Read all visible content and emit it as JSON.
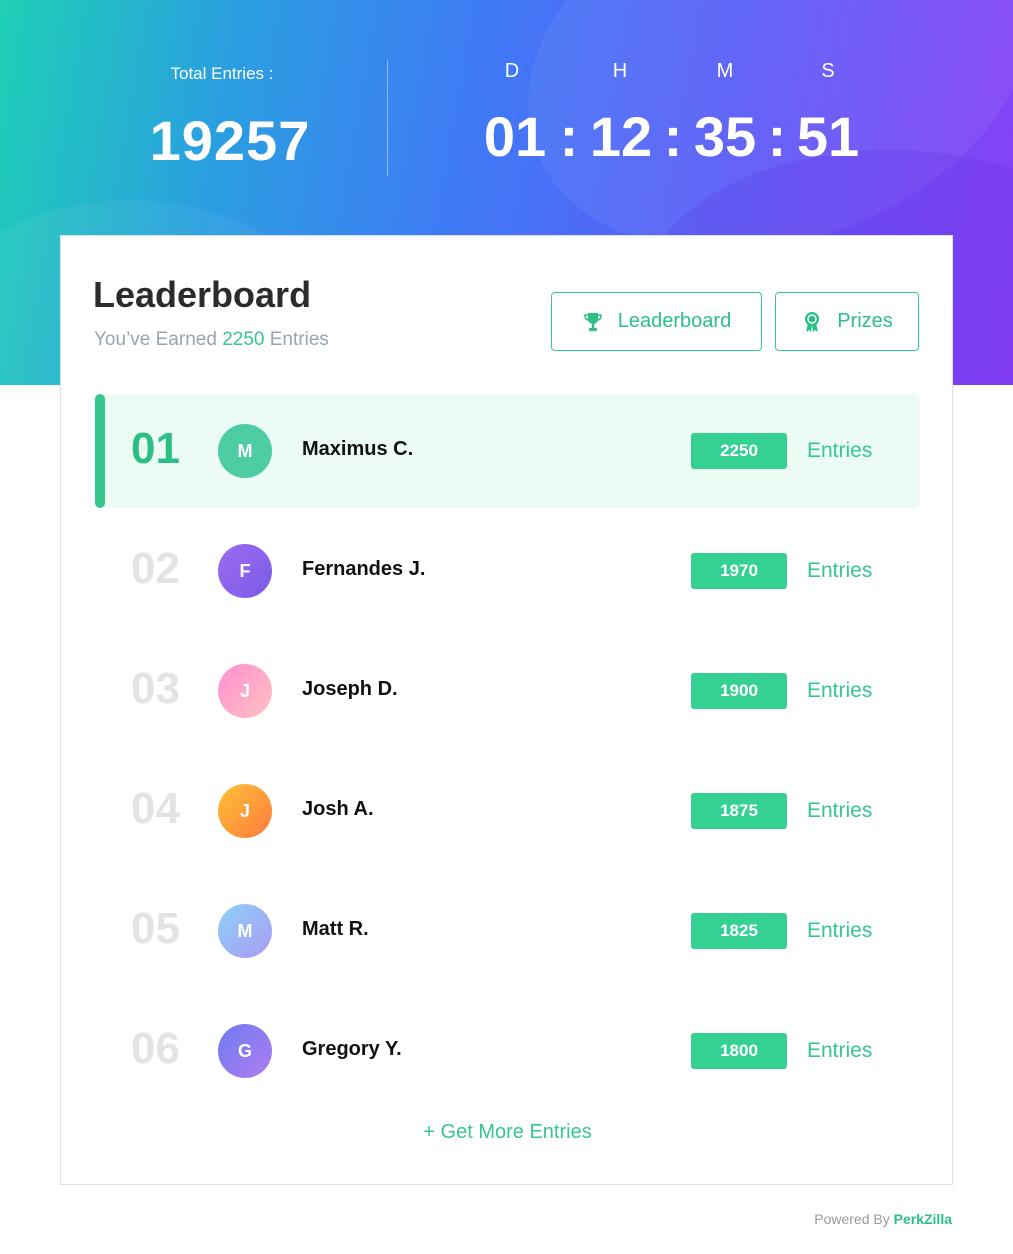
{
  "header": {
    "total_label": "Total Entries :",
    "total_value": "19257",
    "countdown": {
      "labels": [
        "D",
        "H",
        "M",
        "S"
      ],
      "values": [
        "01",
        "12",
        "35",
        "51"
      ],
      "separator": ":"
    }
  },
  "card": {
    "title": "Leaderboard",
    "subtitle_prefix": "You’ve Earned",
    "subtitle_value": "2250",
    "subtitle_suffix": "Entries",
    "tabs": [
      {
        "label": "Leaderboard",
        "icon": "trophy-icon"
      },
      {
        "label": "Prizes",
        "icon": "award-ribbon-icon"
      }
    ],
    "rows": [
      {
        "rank": "01",
        "initial": "M",
        "name": "Maximus C.",
        "entries": "2250",
        "unit": "Entries"
      },
      {
        "rank": "02",
        "initial": "F",
        "name": "Fernandes J.",
        "entries": "1970",
        "unit": "Entries"
      },
      {
        "rank": "03",
        "initial": "J",
        "name": "Joseph D.",
        "entries": "1900",
        "unit": "Entries"
      },
      {
        "rank": "04",
        "initial": "J",
        "name": "Josh A.",
        "entries": "1875",
        "unit": "Entries"
      },
      {
        "rank": "05",
        "initial": "M",
        "name": "Matt R.",
        "entries": "1825",
        "unit": "Entries"
      },
      {
        "rank": "06",
        "initial": "G",
        "name": "Gregory Y.",
        "entries": "1800",
        "unit": "Entries"
      }
    ],
    "more_link": "+ Get More Entries"
  },
  "footer": {
    "powered_prefix": "Powered By",
    "brand": "PerkZilla"
  },
  "colors": {
    "accent": "#35c78e",
    "highlight_row": "#ecfcf4",
    "rank_muted": "#e3e3e3"
  }
}
